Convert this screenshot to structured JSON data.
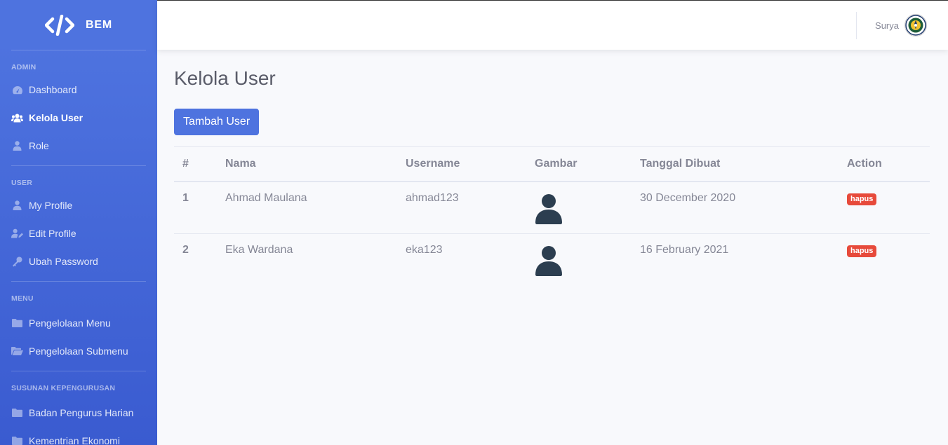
{
  "brand": {
    "name": "BEM",
    "icon": "code-icon"
  },
  "sidebar": {
    "sections": [
      {
        "heading": "ADMIN",
        "items": [
          {
            "label": "Dashboard",
            "icon": "tachometer-icon",
            "active": false
          },
          {
            "label": "Kelola User",
            "icon": "users-icon",
            "active": true
          },
          {
            "label": "Role",
            "icon": "user-tie-icon",
            "active": false
          }
        ]
      },
      {
        "heading": "USER",
        "items": [
          {
            "label": "My Profile",
            "icon": "user-icon",
            "active": false
          },
          {
            "label": "Edit Profile",
            "icon": "user-edit-icon",
            "active": false
          },
          {
            "label": "Ubah Password",
            "icon": "key-icon",
            "active": false
          }
        ]
      },
      {
        "heading": "MENU",
        "items": [
          {
            "label": "Pengelolaan Menu",
            "icon": "folder-icon",
            "active": false
          },
          {
            "label": "Pengelolaan Submenu",
            "icon": "folder-open-icon",
            "active": false
          }
        ]
      },
      {
        "heading": "SUSUNAN KEPENGURUSAN",
        "items": [
          {
            "label": "Badan Pengurus Harian",
            "icon": "folder-icon",
            "active": false
          },
          {
            "label": "Kementrian Ekonomi",
            "icon": "folder-icon",
            "active": false
          }
        ]
      }
    ]
  },
  "topbar": {
    "user_name": "Surya",
    "avatar_icon": "university-logo-icon"
  },
  "page": {
    "title": "Kelola User",
    "add_button": "Tambah User"
  },
  "table": {
    "headers": [
      "#",
      "Nama",
      "Username",
      "Gambar",
      "Tanggal Dibuat",
      "Action"
    ],
    "rows": [
      {
        "num": "1",
        "nama": "Ahmad Maulana",
        "username": "ahmad123",
        "gambar": "user-avatar-icon",
        "tanggal": "30 December 2020",
        "action": "hapus"
      },
      {
        "num": "2",
        "nama": "Eka Wardana",
        "username": "eka123",
        "gambar": "user-avatar-icon",
        "tanggal": "16 February 2021",
        "action": "hapus"
      }
    ]
  },
  "colors": {
    "primary": "#4e73df",
    "danger": "#e74a3b",
    "text": "#858796",
    "heading": "#5a5c69",
    "avatar": "#2c3e50"
  }
}
